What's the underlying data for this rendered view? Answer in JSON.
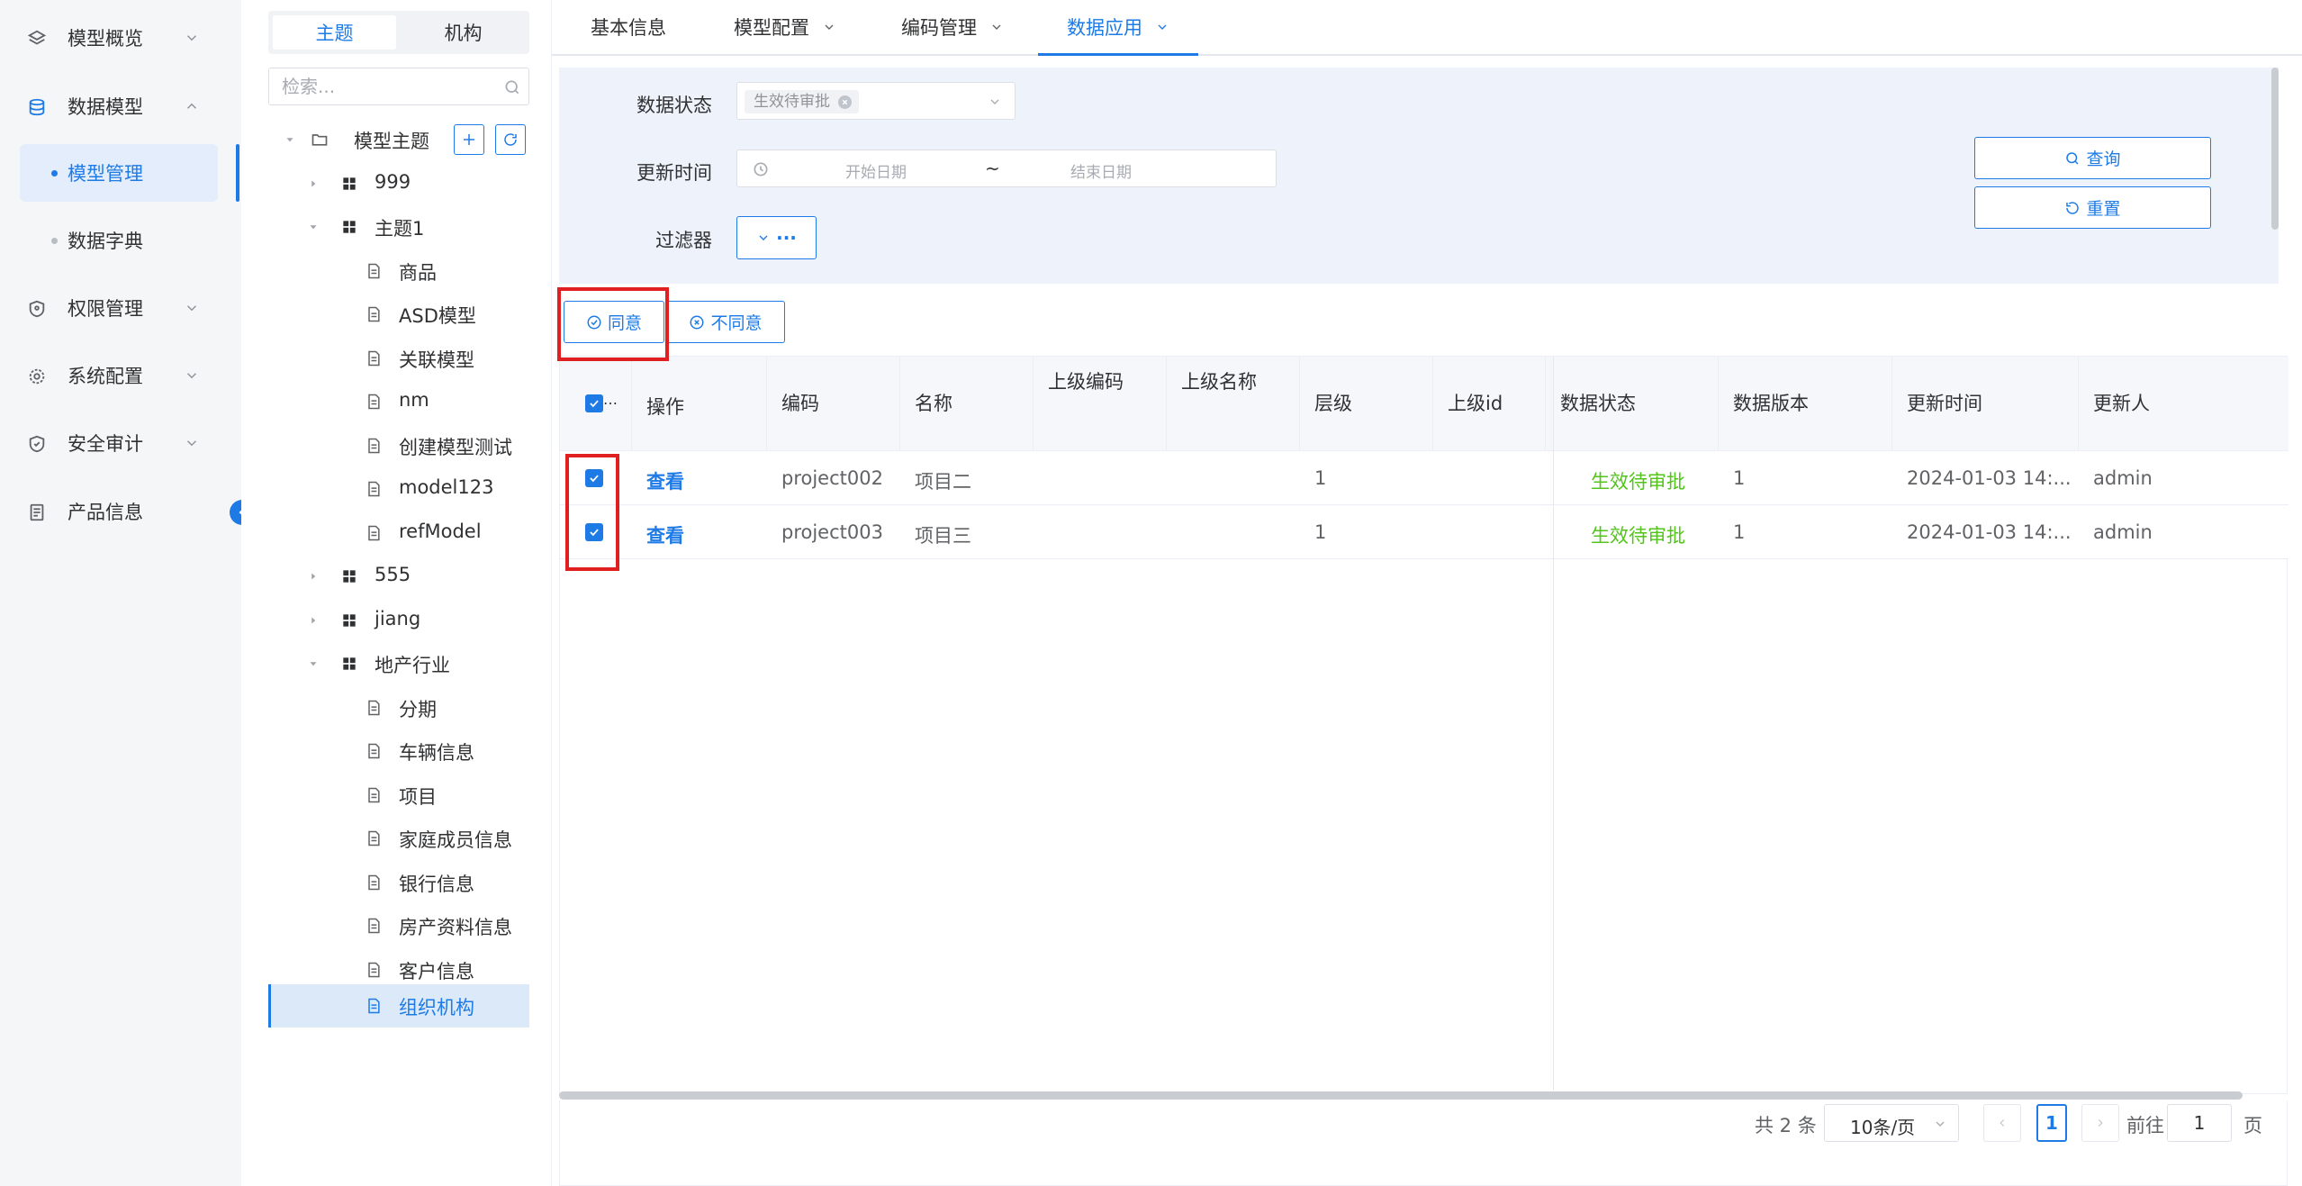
{
  "nav": {
    "items": [
      {
        "label": "模型概览",
        "icon": "layers-icon"
      },
      {
        "label": "数据模型",
        "icon": "database-icon"
      },
      {
        "label": "权限管理",
        "icon": "shield-icon"
      },
      {
        "label": "系统配置",
        "icon": "gear-icon"
      },
      {
        "label": "安全审计",
        "icon": "shield-check-icon"
      },
      {
        "label": "产品信息",
        "icon": "document-icon"
      }
    ],
    "sub_items": [
      {
        "label": "模型管理"
      },
      {
        "label": "数据字典"
      }
    ]
  },
  "tree": {
    "tabs": [
      "主题",
      "机构"
    ],
    "search_placeholder": "检索...",
    "root": "模型主题",
    "nodes": [
      {
        "label": "999"
      },
      {
        "label": "主题1"
      },
      {
        "label": "商品"
      },
      {
        "label": "ASD模型"
      },
      {
        "label": "关联模型"
      },
      {
        "label": "nm"
      },
      {
        "label": "创建模型测试"
      },
      {
        "label": "model123"
      },
      {
        "label": "refModel"
      },
      {
        "label": "555"
      },
      {
        "label": "jiang"
      },
      {
        "label": "地产行业"
      },
      {
        "label": "分期"
      },
      {
        "label": "车辆信息"
      },
      {
        "label": "项目"
      },
      {
        "label": "家庭成员信息"
      },
      {
        "label": "银行信息"
      },
      {
        "label": "房产资料信息"
      },
      {
        "label": "客户信息"
      },
      {
        "label": "组织机构"
      }
    ]
  },
  "top_tabs": [
    "基本信息",
    "模型配置",
    "编码管理",
    "数据应用"
  ],
  "filters": {
    "status_label": "数据状态",
    "status_value": "生效待审批",
    "time_label": "更新时间",
    "start_placeholder": "开始日期",
    "separator": "~",
    "end_placeholder": "结束日期",
    "filter_label": "过滤器",
    "more_label": "···",
    "query_label": "查询",
    "reset_label": "重置"
  },
  "actions": {
    "agree": "同意",
    "disagree": "不同意"
  },
  "table": {
    "headers": [
      "操作",
      "编码",
      "名称",
      "上级编码",
      "上级名称",
      "层级",
      "上级id",
      "数据状态",
      "数据版本",
      "更新时间",
      "更新人"
    ],
    "rows": [
      {
        "action": "查看",
        "code": "project002",
        "name": "项目二",
        "parent_code": "",
        "parent_name": "",
        "level": "1",
        "parent_id": "",
        "status": "生效待审批",
        "version": "1",
        "updated": "2024-01-03 14:...",
        "updater": "admin"
      },
      {
        "action": "查看",
        "code": "project003",
        "name": "项目三",
        "parent_code": "",
        "parent_name": "",
        "level": "1",
        "parent_id": "",
        "status": "生效待审批",
        "version": "1",
        "updated": "2024-01-03 14:...",
        "updater": "admin"
      }
    ]
  },
  "pager": {
    "total": "共 2 条",
    "page_size": "10条/页",
    "current": "1",
    "goto_prefix": "前往",
    "goto_value": "1",
    "goto_suffix": "页"
  },
  "colors": {
    "accent": "#1e7be6",
    "status_green": "#52c41a",
    "highlight_red": "#e02020"
  }
}
